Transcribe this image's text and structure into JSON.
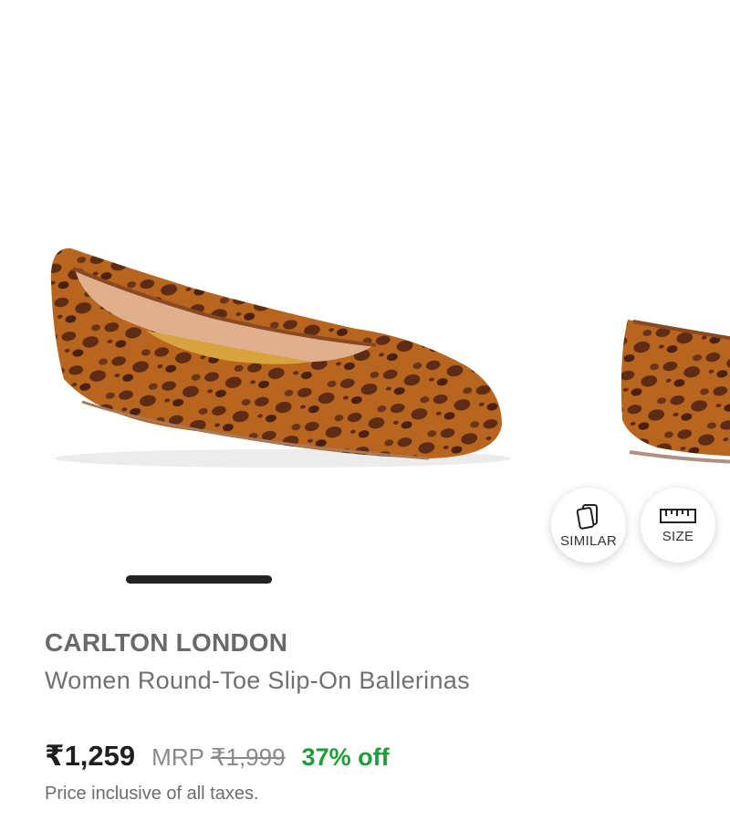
{
  "product": {
    "brand": "CARLTON LONDON",
    "name": "Women Round-Toe Slip-On Ballerinas",
    "price": "₹1,259",
    "mrp_label": "MRP",
    "mrp_value": "₹1,999",
    "discount": "37% off",
    "tax_note": "Price inclusive of all taxes."
  },
  "actions": {
    "similar_label": "SIMILAR",
    "similar_icon": "cards-icon",
    "size_label": "SIZE",
    "size_icon": "ruler-icon"
  },
  "carousel": {
    "images": [
      "leopard-print-ballerina-flat",
      "leopard-print-ballerina-flat-alt-view"
    ],
    "active_index": 0
  },
  "colors": {
    "discount": "#1f9d3a",
    "leopard_base": "#b8651f",
    "leopard_spot": "#5e2c14"
  }
}
